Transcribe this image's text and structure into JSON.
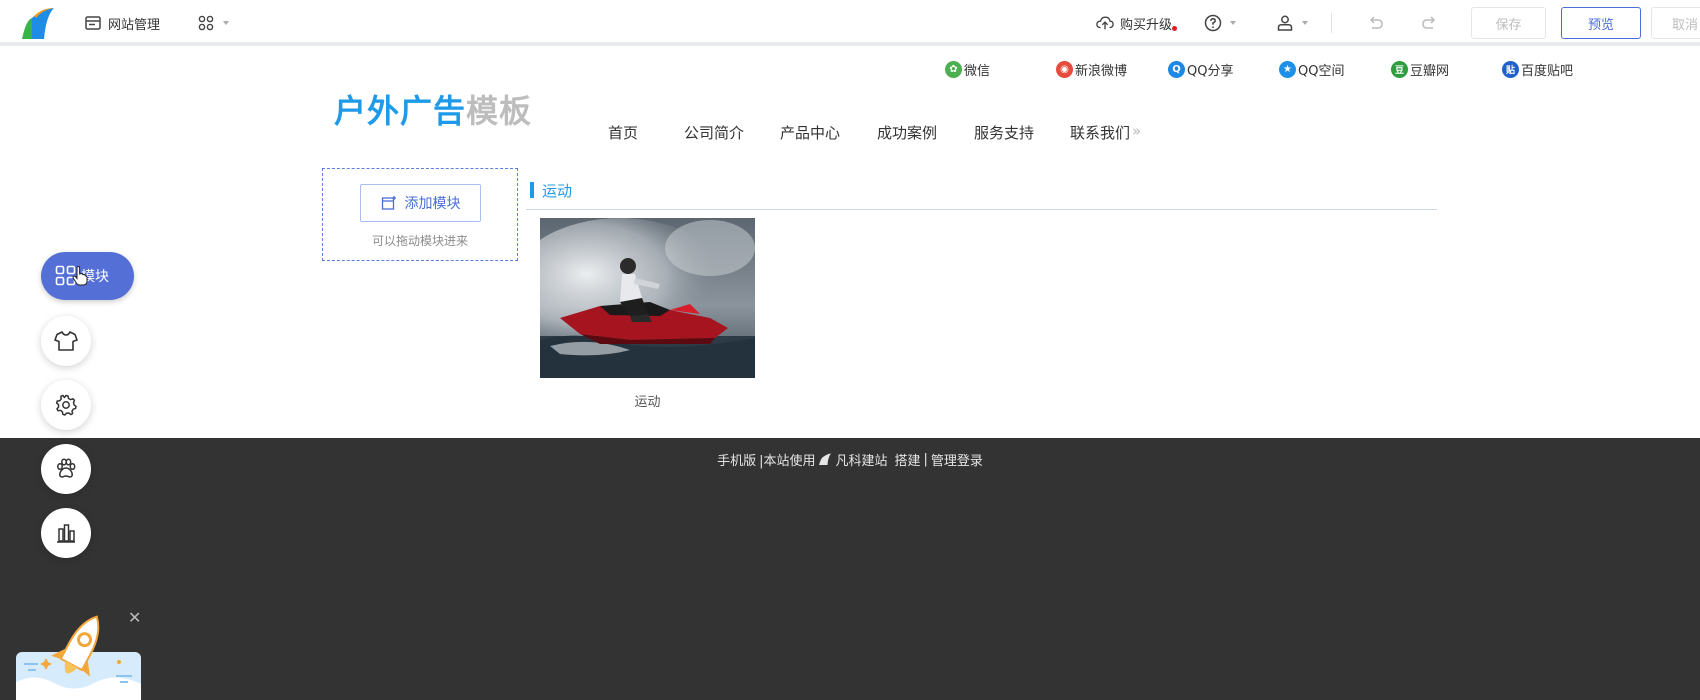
{
  "toolbar": {
    "site_manage": "网站管理",
    "buy_upgrade": "购买升级",
    "save": "保存",
    "preview": "预览",
    "cancel": "取消"
  },
  "share": {
    "items": [
      {
        "label": "微信",
        "color": "#4caf50",
        "glyph": "✿"
      },
      {
        "label": "新浪微博",
        "color": "#e64b3c",
        "glyph": "◉"
      },
      {
        "label": "QQ分享",
        "color": "#1e88e5",
        "glyph": "Q"
      },
      {
        "label": "QQ空间",
        "color": "#1e90e6",
        "glyph": "★"
      },
      {
        "label": "豆瓣网",
        "color": "#2e9c3f",
        "glyph": "豆"
      },
      {
        "label": "百度贴吧",
        "color": "#2062c9",
        "glyph": "贴"
      }
    ]
  },
  "site": {
    "title_part1": "户外广告",
    "title_part2": "模板",
    "accent": "#1f9ae8"
  },
  "nav": {
    "items": [
      "首页",
      "公司简介",
      "产品中心",
      "成功案例",
      "服务支持",
      "联系我们"
    ],
    "more": "»"
  },
  "module_area": {
    "add_label": "添加模块",
    "hint": "可以拖动模块进来"
  },
  "section": {
    "title": "运动",
    "caption": "运动"
  },
  "footer": {
    "mobile": "手机版",
    "uses": "|本站使用",
    "brand": "凡科建站",
    "build": "搭建",
    "sep": "|",
    "admin_login": "管理登录"
  },
  "sidebar": {
    "module_label": "模块"
  }
}
